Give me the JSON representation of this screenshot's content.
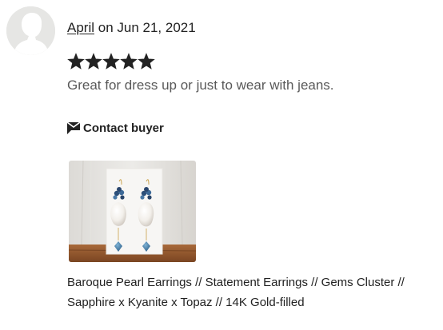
{
  "review": {
    "reviewer_name": "April",
    "date_text": " on Jun 21, 2021",
    "rating": 5,
    "rating_max": 5,
    "text": "Great for dress up or just to wear with jeans.",
    "contact_label": "Contact buyer",
    "contact_icon": "message-icon"
  },
  "product": {
    "title": "Baroque Pearl Earrings // Statement Earrings // Gems Cluster // Sapphire x Kyanite x Topaz // 14K Gold-filled"
  },
  "colors": {
    "star": "#222222",
    "secondary_text": "#595959"
  }
}
